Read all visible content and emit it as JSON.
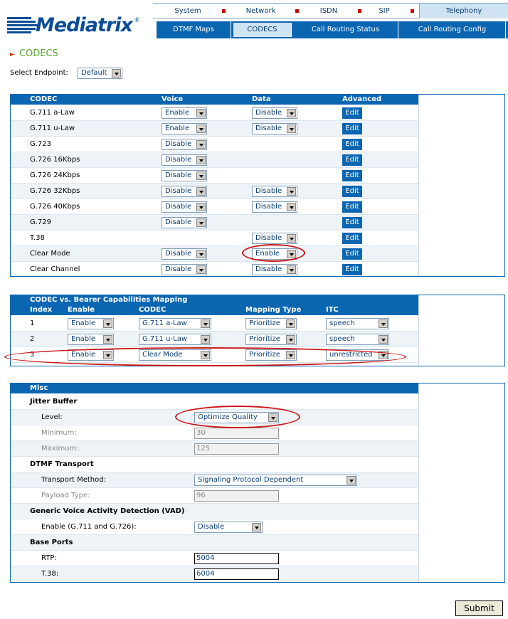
{
  "brand": {
    "name": "Mediatrix",
    "reg": "®"
  },
  "nav_top": [
    "System",
    "Network",
    "ISDN",
    "SIP",
    "Telephony"
  ],
  "nav_sub": [
    "DTMF Maps",
    "CODECS",
    "Call Routing Status",
    "Call Routing Config"
  ],
  "page_title": "CODECS",
  "endpoint": {
    "label": "Select Endpoint:",
    "value": "Default"
  },
  "codec_table": {
    "headers": [
      "CODEC",
      "Voice",
      "Data",
      "Advanced"
    ],
    "edit_label": "Edit",
    "rows": [
      {
        "name": "G.711 a-Law",
        "voice": "Enable",
        "data": "Disable"
      },
      {
        "name": "G.711 u-Law",
        "voice": "Enable",
        "data": "Disable"
      },
      {
        "name": "G.723",
        "voice": "Disable",
        "data": ""
      },
      {
        "name": "G.726 16Kbps",
        "voice": "Disable",
        "data": ""
      },
      {
        "name": "G.726 24Kbps",
        "voice": "Disable",
        "data": ""
      },
      {
        "name": "G.726 32Kbps",
        "voice": "Disable",
        "data": "Disable"
      },
      {
        "name": "G.726 40Kbps",
        "voice": "Disable",
        "data": "Disable"
      },
      {
        "name": "G.729",
        "voice": "Disable",
        "data": ""
      },
      {
        "name": "T.38",
        "voice": "",
        "data": "Disable"
      },
      {
        "name": "Clear Mode",
        "voice": "Disable",
        "data": "Enable"
      },
      {
        "name": "Clear Channel",
        "voice": "Disable",
        "data": "Disable"
      }
    ]
  },
  "bearer_table": {
    "title": "CODEC vs. Bearer Capabilities Mapping",
    "headers": [
      "Index",
      "Enable",
      "CODEC",
      "Mapping Type",
      "ITC"
    ],
    "rows": [
      {
        "index": "1",
        "enable": "Enable",
        "codec": "G.711 a-Law",
        "mapping": "Prioritize",
        "itc": "speech"
      },
      {
        "index": "2",
        "enable": "Enable",
        "codec": "G.711 u-Law",
        "mapping": "Prioritize",
        "itc": "speech"
      },
      {
        "index": "3",
        "enable": "Enable",
        "codec": "Clear Mode",
        "mapping": "Prioritize",
        "itc": "unrestricted"
      }
    ]
  },
  "misc": {
    "title": "Misc",
    "jitter": {
      "title": "Jitter Buffer",
      "level_label": "Level:",
      "level_value": "Optimize Quality",
      "min_label": "Minimum:",
      "min_value": "30",
      "max_label": "Maximum:",
      "max_value": "125"
    },
    "dtmf": {
      "title": "DTMF Transport",
      "method_label": "Transport Method:",
      "method_value": "Signaling Protocol Dependent",
      "payload_label": "Payload Type:",
      "payload_value": "96"
    },
    "vad": {
      "title": "Generic Voice Activity Detection (VAD)",
      "enable_label": "Enable (G.711 and G.726):",
      "enable_value": "Disable"
    },
    "ports": {
      "title": "Base Ports",
      "rtp_label": "RTP:",
      "rtp_value": "5004",
      "t38_label": "T.38:",
      "t38_value": "6004"
    }
  },
  "submit_label": "Submit",
  "colors": {
    "accent": "#0b66b2",
    "title_green": "#5aa52d",
    "highlight_red": "#cc1a1a"
  }
}
